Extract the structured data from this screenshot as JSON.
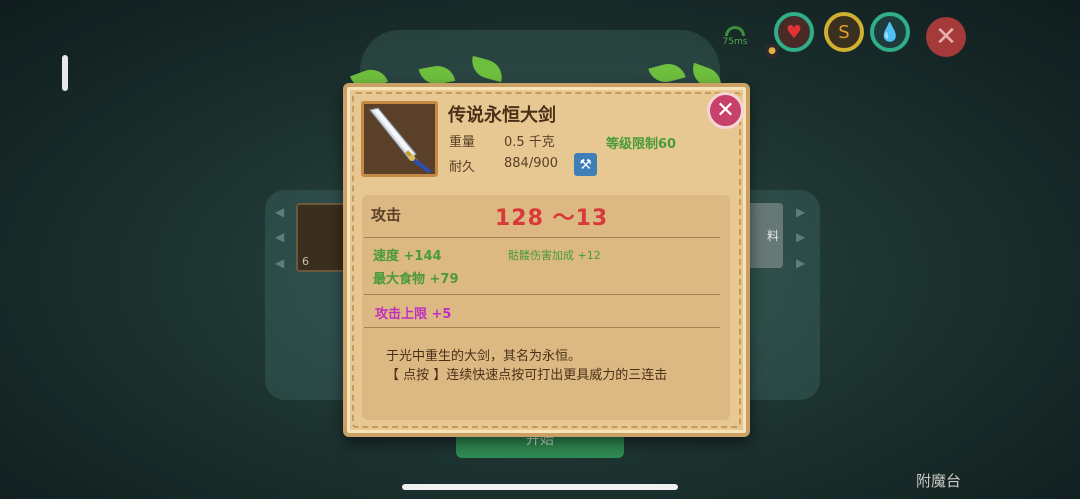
{
  "hud": {
    "ping": "75ms",
    "close_icon": "close-icon",
    "health_icon": "heart-icon",
    "food_icon": "stomach-icon",
    "water_icon": "water-drop-icon"
  },
  "background": {
    "slot_right_text": "料",
    "start_button": "开始",
    "bottom_label": "附魔台",
    "slot_left_badge": "6"
  },
  "item": {
    "name": "传说永恒大剑",
    "weight_label": "重量",
    "weight_value": "0.5 千克",
    "durability_label": "耐久",
    "durability_value": "884/900",
    "level_req": "等级限制60",
    "icon": "greatsword-icon"
  },
  "stats": {
    "attack_label": "攻击",
    "attack_value": "128 ～13",
    "speed": "速度 +144",
    "skeleton_damage": "骷髅伤害加成 +12",
    "max_food": "最大食物 +79",
    "attack_cap": "攻击上限 +5"
  },
  "description": {
    "line1": "于光中重生的大剑，其名为永恒。",
    "line2": "【 点按 】连续快速点按可打出更具威力的三连击"
  },
  "colors": {
    "attack_red": "#d83a3a",
    "bonus_green": "#4a9a3a",
    "special_magenta": "#c030c0",
    "card_bg": "#e8c892",
    "close_pink": "#c8416a"
  }
}
